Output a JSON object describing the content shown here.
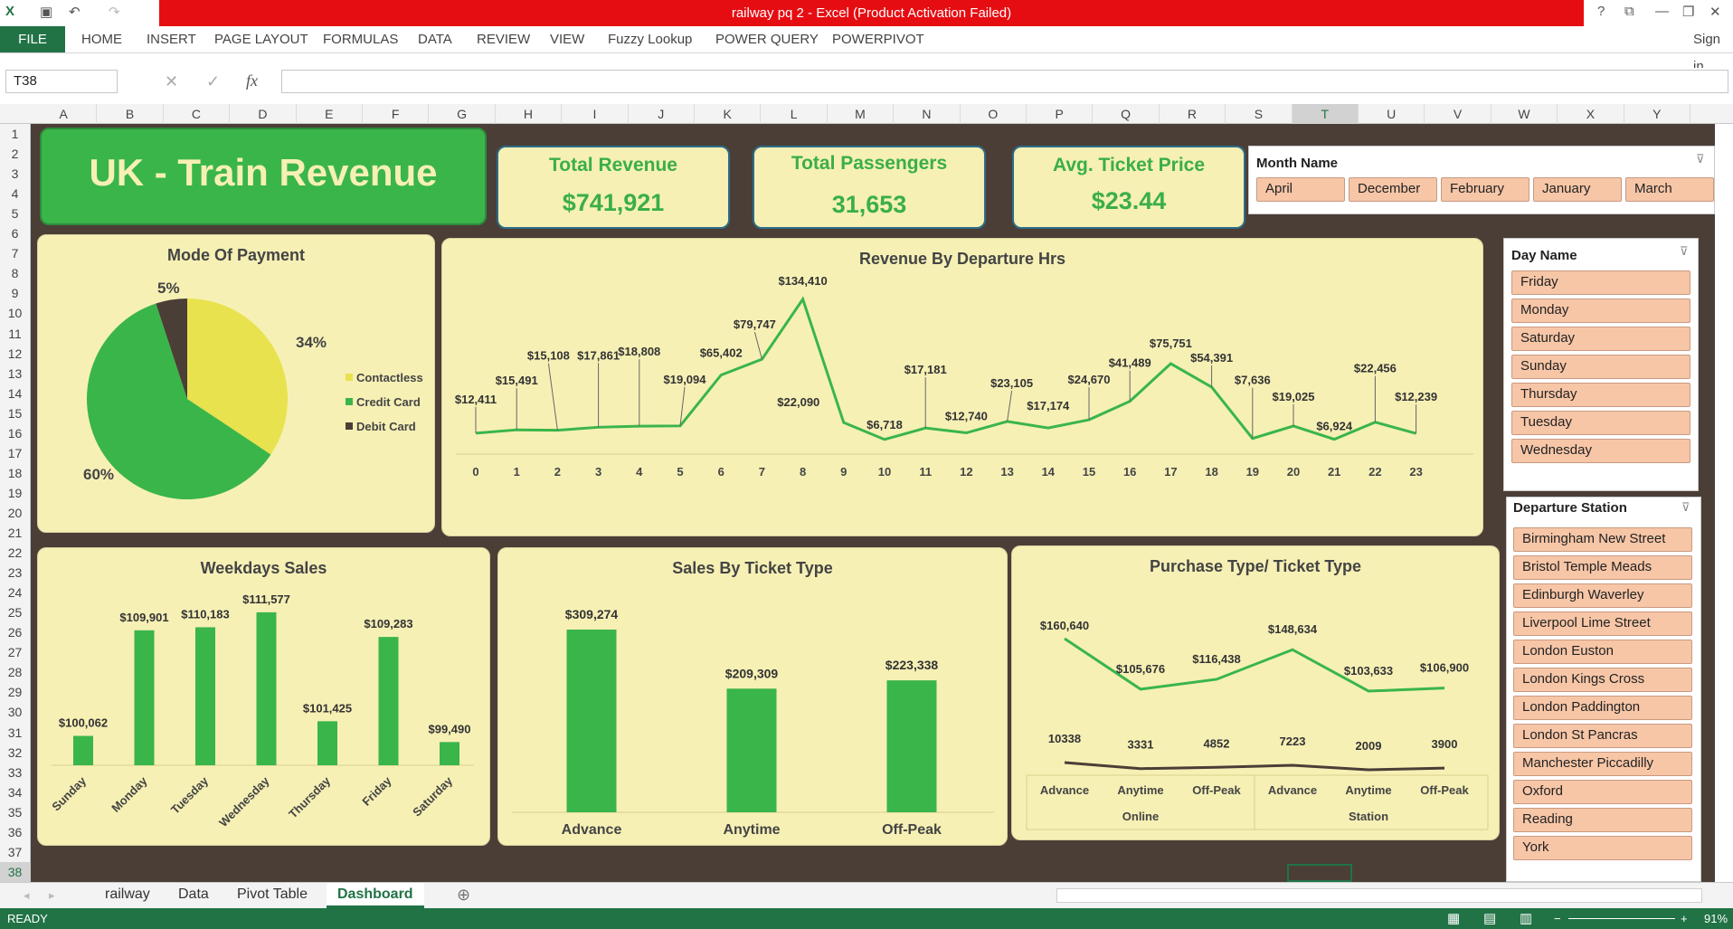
{
  "window": {
    "title": "railway pq 2 -  Excel (Product Activation Failed)",
    "sign_in": "Sign in"
  },
  "ribbon": {
    "file": "FILE",
    "tabs": [
      "HOME",
      "INSERT",
      "PAGE LAYOUT",
      "FORMULAS",
      "DATA",
      "REVIEW",
      "VIEW",
      "Fuzzy Lookup",
      "POWER QUERY",
      "POWERPIVOT"
    ]
  },
  "formula_bar": {
    "name_box": "T38",
    "fx": "fx",
    "value": ""
  },
  "columns": [
    "A",
    "B",
    "C",
    "D",
    "E",
    "F",
    "G",
    "H",
    "I",
    "J",
    "K",
    "L",
    "M",
    "N",
    "O",
    "P",
    "Q",
    "R",
    "S",
    "T",
    "U",
    "V",
    "W",
    "X",
    "Y"
  ],
  "rows": [
    "1",
    "2",
    "3",
    "4",
    "5",
    "6",
    "7",
    "8",
    "9",
    "10",
    "11",
    "12",
    "13",
    "14",
    "15",
    "16",
    "17",
    "18",
    "19",
    "20",
    "21",
    "22",
    "23",
    "24",
    "25",
    "26",
    "27",
    "28",
    "29",
    "30",
    "31",
    "32",
    "33",
    "34",
    "35",
    "36",
    "37",
    "38"
  ],
  "dashboard": {
    "title": "UK - Train Revenue",
    "kpis": [
      {
        "label": "Total Revenue",
        "value": "$741,921"
      },
      {
        "label": "Total Passengers",
        "value": "31,653"
      },
      {
        "label": "Avg. Ticket Price",
        "value": "$23.44"
      }
    ],
    "month_slicer": {
      "title": "Month Name",
      "items": [
        "April",
        "December",
        "February",
        "January",
        "March"
      ]
    },
    "day_slicer": {
      "title": "Day Name",
      "items": [
        "Friday",
        "Monday",
        "Saturday",
        "Sunday",
        "Thursday",
        "Tuesday",
        "Wednesday"
      ]
    },
    "station_slicer": {
      "title": "Departure Station",
      "items": [
        "Birmingham New Street",
        "Bristol Temple Meads",
        "Edinburgh Waverley",
        "Liverpool Lime Street",
        "London Euston",
        "London Kings Cross",
        "London Paddington",
        "London St Pancras",
        "Manchester Piccadilly",
        "Oxford",
        "Reading",
        "York"
      ]
    }
  },
  "colors": {
    "green": "#3ab54a",
    "yellow": "#e8e24e",
    "brown": "#4a3e37",
    "panel": "#f6f0b5"
  },
  "chart_data": [
    {
      "type": "pie",
      "title": "Mode Of Payment",
      "categories": [
        "Contactless",
        "Credit Card",
        "Debit Card"
      ],
      "values": [
        34,
        60,
        5
      ],
      "labels": [
        "34%",
        "60%",
        "5%"
      ],
      "legend": "right"
    },
    {
      "type": "line",
      "title": "Revenue By Departure Hrs",
      "x": [
        "0",
        "1",
        "2",
        "3",
        "4",
        "5",
        "6",
        "7",
        "8",
        "9",
        "10",
        "11",
        "12",
        "13",
        "14",
        "15",
        "16",
        "17",
        "18",
        "19",
        "20",
        "21",
        "22",
        "23"
      ],
      "values": [
        12411,
        15491,
        15108,
        17861,
        18808,
        19094,
        65402,
        79747,
        134410,
        22090,
        6718,
        17181,
        12740,
        23105,
        17174,
        24670,
        41489,
        75751,
        54391,
        7636,
        19025,
        6924,
        22456,
        12239
      ],
      "labels": [
        "$12,411",
        "$15,491",
        "$15,108",
        "$17,861",
        "$18,808",
        "$19,094",
        "$65,402",
        "$79,747",
        "$134,410",
        "$22,090",
        "$6,718",
        "$17,181",
        "$12,740",
        "$23,105",
        "$17,174",
        "$24,670",
        "$41,489",
        "$75,751",
        "$54,391",
        "$7,636",
        "$19,025",
        "$6,924",
        "$22,456",
        "$12,239"
      ]
    },
    {
      "type": "bar",
      "title": "Weekdays Sales",
      "categories": [
        "Sunday",
        "Monday",
        "Tuesday",
        "Wednesday",
        "Thursday",
        "Friday",
        "Saturday"
      ],
      "values": [
        100062,
        109901,
        110183,
        111577,
        101425,
        109283,
        99490
      ],
      "labels": [
        "$100,062",
        "$109,901",
        "$110,183",
        "$111,577",
        "$101,425",
        "$109,283",
        "$99,490"
      ]
    },
    {
      "type": "bar",
      "title": "Sales By Ticket Type",
      "categories": [
        "Advance",
        "Anytime",
        "Off-Peak"
      ],
      "values": [
        309274,
        209309,
        223338
      ],
      "labels": [
        "$309,274",
        "$209,309",
        "$223,338"
      ]
    },
    {
      "type": "line",
      "title": "Purchase Type/ Ticket Type",
      "categories": [
        "Advance",
        "Anytime",
        "Off-Peak",
        "Advance",
        "Anytime",
        "Off-Peak"
      ],
      "groups": [
        "Online",
        "Station"
      ],
      "series": [
        {
          "values": [
            160640,
            105676,
            116438,
            148634,
            103633,
            106900
          ],
          "labels": [
            "$160,640",
            "$105,676",
            "$116,438",
            "$148,634",
            "$103,633",
            "$106,900"
          ]
        },
        {
          "values": [
            10338,
            3331,
            4852,
            7223,
            2009,
            3900
          ],
          "labels": [
            "10338",
            "3331",
            "4852",
            "7223",
            "2009",
            "3900"
          ]
        }
      ]
    }
  ],
  "sheets": [
    "railway",
    "Data",
    "Pivot Table",
    "Dashboard"
  ],
  "status": {
    "ready": "READY",
    "zoom": "91%"
  }
}
